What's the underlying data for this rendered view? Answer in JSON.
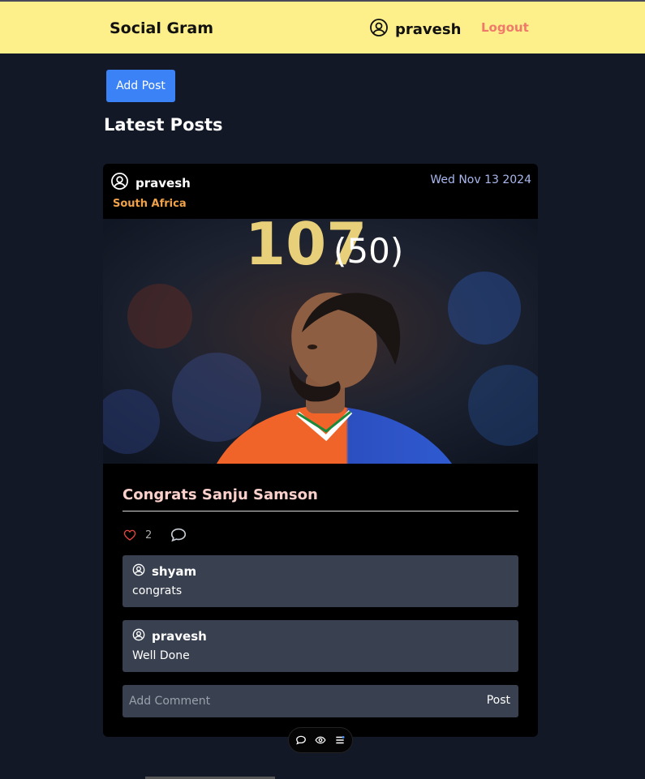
{
  "navbar": {
    "brand": "Social Gram",
    "username": "pravesh",
    "logout_label": "Logout",
    "user_icon": "user-circle-icon"
  },
  "add_post_label": "Add Post",
  "section_title": "Latest Posts",
  "post": {
    "author": "pravesh",
    "date": "Wed Nov 13 2024",
    "location": "South Africa",
    "image_overlay_main": "107",
    "image_overlay_sub": "(50)",
    "title": "Congrats Sanju Samson",
    "likes": "2",
    "comments": [
      {
        "user": "shyam",
        "text": "congrats"
      },
      {
        "user": "pravesh",
        "text": "Well Done"
      }
    ],
    "comment_placeholder": "Add Comment",
    "post_button_label": "Post"
  },
  "colors": {
    "navbar_bg": "#fdef8a",
    "page_bg": "#131826",
    "accent_blue": "#3b82f6",
    "location": "#f0a24a",
    "title": "#fcd1cc",
    "logout": "#f07a6a",
    "comment_bg": "#394150"
  },
  "icons": [
    "user-circle-icon",
    "heart-icon",
    "comment-bubble-icon",
    "chat-icon",
    "eye-icon",
    "list-icon"
  ]
}
